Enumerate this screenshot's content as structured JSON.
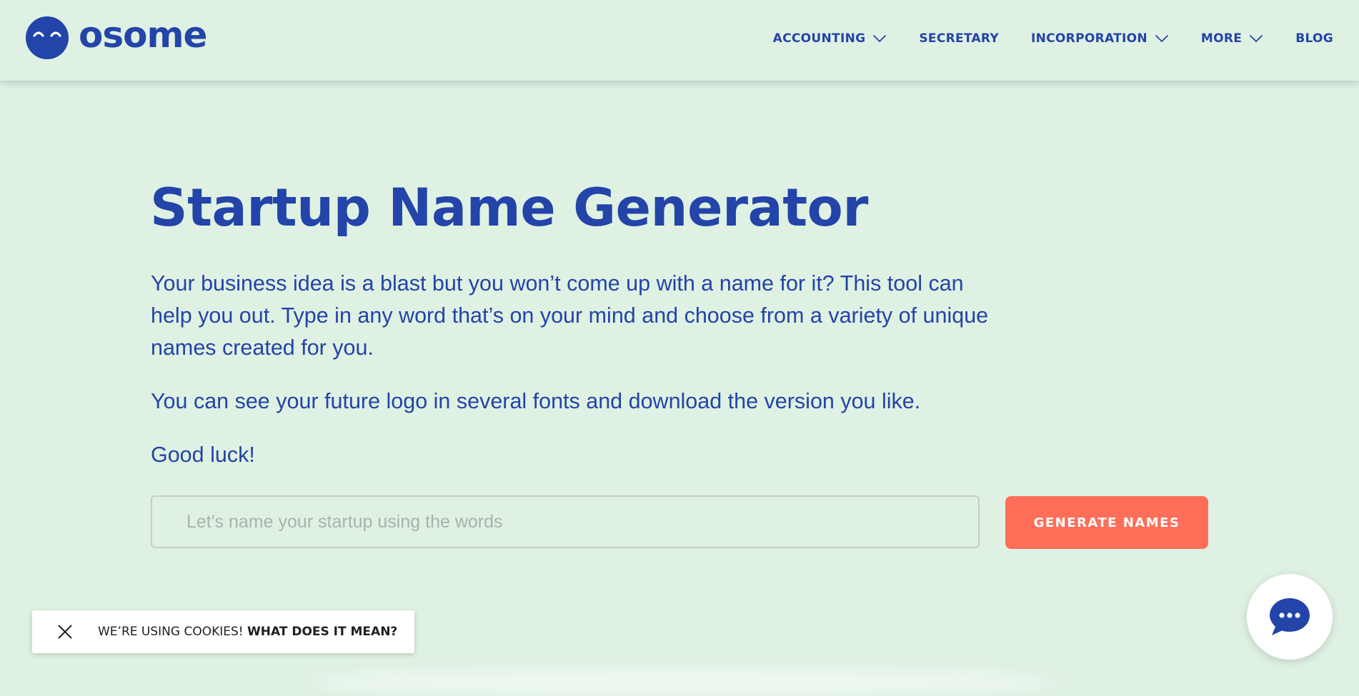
{
  "brand": {
    "name": "osome",
    "logo_icon": "smiling-face-logo-icon",
    "color": "#2344a8"
  },
  "nav": {
    "items": [
      {
        "label": "ACCOUNTING",
        "has_dropdown": true,
        "icon": "chevron-down-icon"
      },
      {
        "label": "SECRETARY",
        "has_dropdown": false
      },
      {
        "label": "INCORPORATION",
        "has_dropdown": true,
        "icon": "chevron-down-icon"
      },
      {
        "label": "MORE",
        "has_dropdown": true,
        "icon": "chevron-down-icon"
      },
      {
        "label": "BLOG",
        "has_dropdown": false
      }
    ]
  },
  "hero": {
    "title": "Startup Name Generator",
    "paragraphs": [
      "Your business idea is a blast but you won’t come up with a name for it? This tool can help you out. Type in any word that’s on your mind and choose from a variety of unique names created for you.",
      "You can see your future logo in several fonts and download the version you like.",
      "Good luck!"
    ]
  },
  "search": {
    "value": "",
    "placeholder": "Let's name your startup using the words"
  },
  "generate_button": {
    "label": "GENERATE NAMES",
    "color": "#fe6e58"
  },
  "cookie_banner": {
    "text": "WE’RE USING COOKIES!",
    "link": "WHAT DOES IT MEAN?",
    "close_icon": "close-icon"
  },
  "chat_widget": {
    "icon": "chat-bubble-icon"
  },
  "colors": {
    "background": "#dff1e3",
    "text": "#2344a8",
    "accent": "#fe6e58",
    "placeholder": "#a9b2ab"
  }
}
